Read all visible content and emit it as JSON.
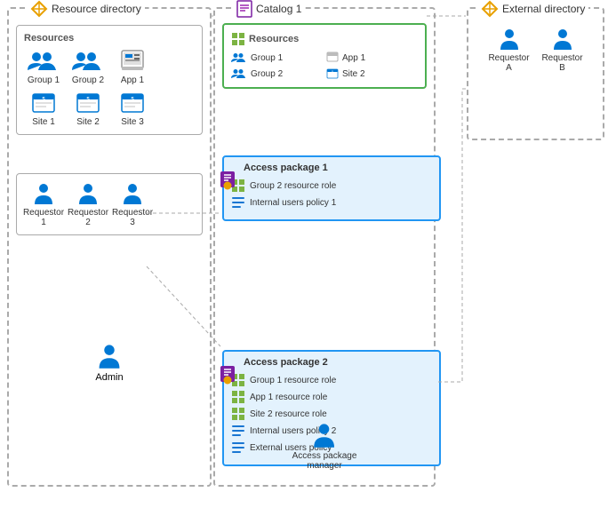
{
  "resourceDirectory": {
    "title": "Resource directory",
    "resources": {
      "label": "Resources",
      "items": [
        {
          "id": "group1",
          "label": "Group 1",
          "type": "group"
        },
        {
          "id": "group2",
          "label": "Group 2",
          "type": "group"
        },
        {
          "id": "app1",
          "label": "App 1",
          "type": "app"
        },
        {
          "id": "site1",
          "label": "Site 1",
          "type": "site"
        },
        {
          "id": "site2",
          "label": "Site 2",
          "type": "site"
        },
        {
          "id": "site3",
          "label": "Site 3",
          "type": "site"
        }
      ]
    },
    "requestors": {
      "items": [
        {
          "id": "req1",
          "label": "Requestor 1",
          "type": "person"
        },
        {
          "id": "req2",
          "label": "Requestor 2",
          "type": "person"
        },
        {
          "id": "req3",
          "label": "Requestor 3",
          "type": "person"
        }
      ]
    },
    "admin": {
      "label": "Admin",
      "type": "admin"
    }
  },
  "externalDirectory": {
    "title": "External directory",
    "requestors": [
      {
        "id": "reqA",
        "label": "Requestor A"
      },
      {
        "id": "reqB",
        "label": "Requestor B"
      }
    ]
  },
  "catalog": {
    "title": "Catalog 1",
    "resources": {
      "label": "Resources",
      "items": [
        {
          "label": "Group 1",
          "type": "group"
        },
        {
          "label": "App 1",
          "type": "app"
        },
        {
          "label": "Group 2",
          "type": "group"
        },
        {
          "label": "Site 2",
          "type": "site"
        }
      ]
    },
    "accessPackage1": {
      "title": "Access package 1",
      "roles": [
        {
          "label": "Group 2 resource role",
          "type": "role"
        }
      ],
      "policies": [
        {
          "label": "Internal users policy 1",
          "type": "policy"
        }
      ]
    },
    "accessPackage2": {
      "title": "Access package 2",
      "roles": [
        {
          "label": "Group 1 resource role",
          "type": "role"
        },
        {
          "label": "App 1 resource role",
          "type": "role"
        },
        {
          "label": "Site 2 resource role",
          "type": "role"
        }
      ],
      "policies": [
        {
          "label": "Internal users policy 2",
          "type": "policy"
        },
        {
          "label": "External users policy",
          "type": "policy"
        }
      ]
    },
    "manager": {
      "label": "Access package\nmanager"
    }
  },
  "colors": {
    "diamond": "#e8a000",
    "blue": "#2196f3",
    "green": "#4caf50",
    "personBlue": "#0078d4",
    "gridColor": "#7cb342",
    "listColor": "#1976d2"
  }
}
